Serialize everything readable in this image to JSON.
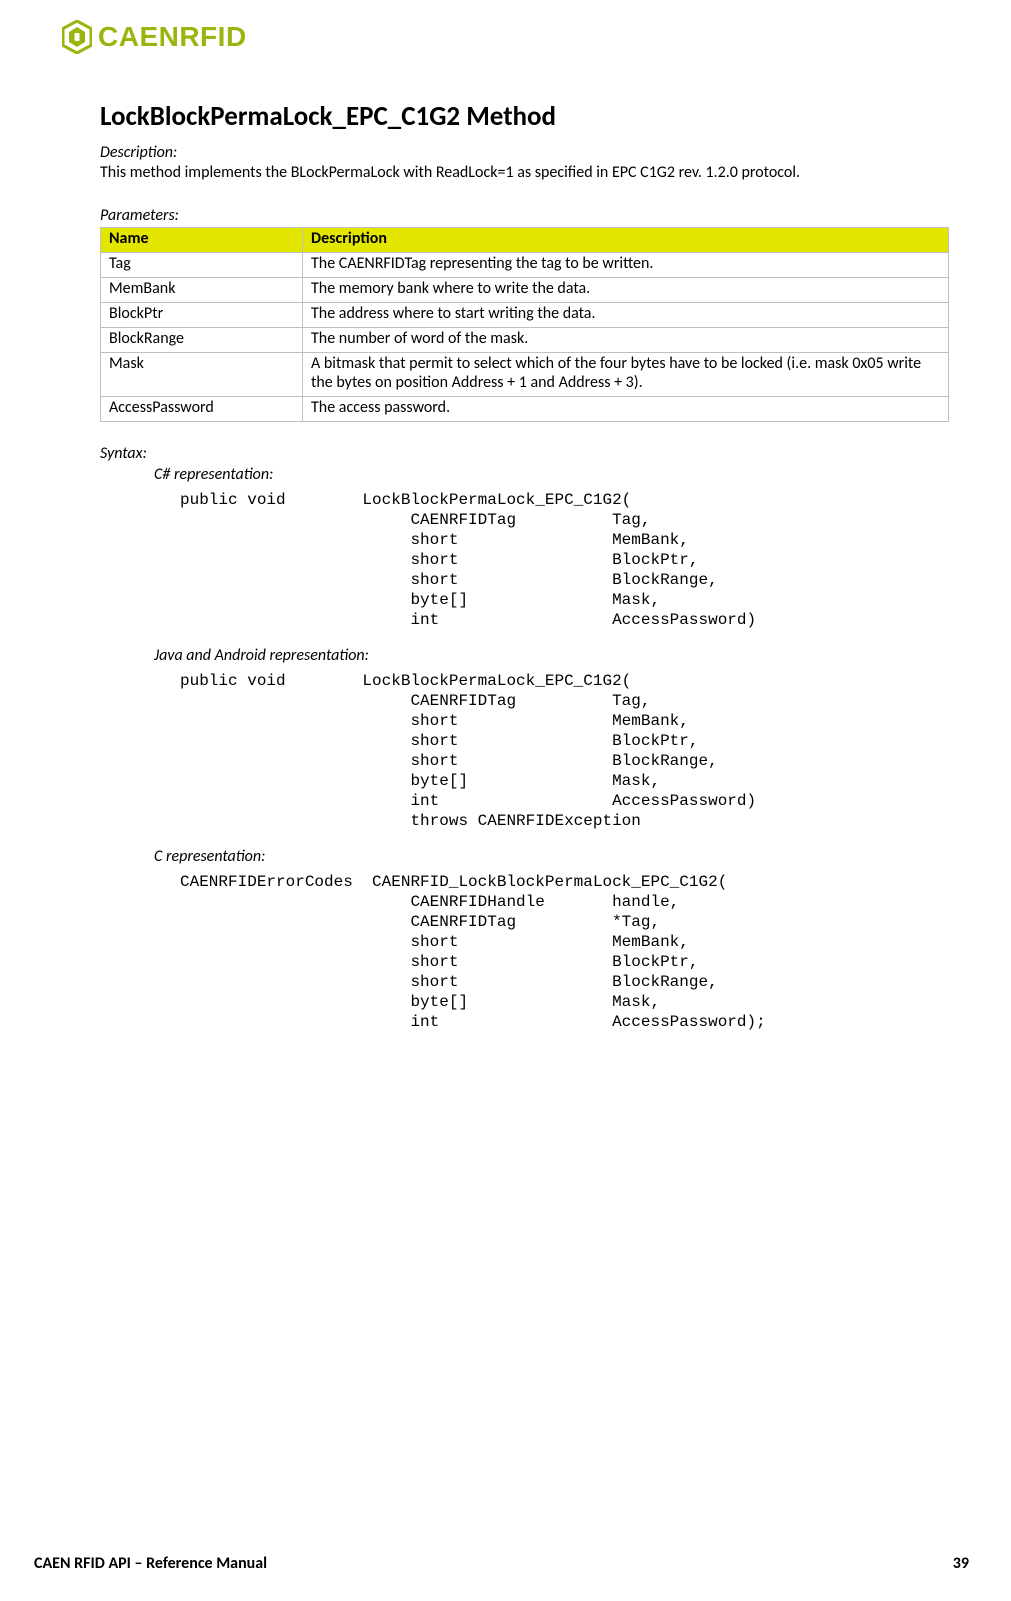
{
  "logo": {
    "brand_text": "CAENRFID"
  },
  "title": "LockBlockPermaLock_EPC_C1G2 Method",
  "description_label": "Description:",
  "description_text": "This method implements the BLockPermaLock with ReadLock=1 as specified in EPC C1G2 rev. 1.2.0 protocol.",
  "parameters_label": "Parameters:",
  "params_table": {
    "headers": {
      "name": "Name",
      "description": "Description"
    },
    "rows": [
      {
        "name": "Tag",
        "description": "The CAENRFIDTag representing the tag to be written."
      },
      {
        "name": "MemBank",
        "description": "The memory bank where to write the data."
      },
      {
        "name": "BlockPtr",
        "description": "The address where to start writing the data."
      },
      {
        "name": "BlockRange",
        "description": "The number of word of the mask."
      },
      {
        "name": "Mask",
        "description": "A bitmask that permit to select which of the four bytes have to be locked (i.e. mask 0x05 write the bytes on position Address + 1 and Address + 3)."
      },
      {
        "name": "AccessPassword",
        "description": "The access password."
      }
    ]
  },
  "syntax_label": "Syntax:",
  "repr": {
    "csharp_label": "C# representation:",
    "csharp_code": "public void        LockBlockPermaLock_EPC_C1G2(\n                        CAENRFIDTag          Tag,\n                        short                MemBank,\n                        short                BlockPtr,\n                        short                BlockRange,\n                        byte[]               Mask,\n                        int                  AccessPassword)",
    "java_label": "Java and Android representation:",
    "java_code": "public void        LockBlockPermaLock_EPC_C1G2(\n                        CAENRFIDTag          Tag,\n                        short                MemBank,\n                        short                BlockPtr,\n                        short                BlockRange,\n                        byte[]               Mask,\n                        int                  AccessPassword)\n                        throws CAENRFIDException",
    "c_label": "C representation:",
    "c_code": "CAENRFIDErrorCodes  CAENRFID_LockBlockPermaLock_EPC_C1G2(\n                        CAENRFIDHandle       handle,\n                        CAENRFIDTag          *Tag,\n                        short                MemBank,\n                        short                BlockPtr,\n                        short                BlockRange,\n                        byte[]               Mask,\n                        int                  AccessPassword);"
  },
  "footer": {
    "manual_title": "CAEN RFID API – Reference Manual",
    "page_number": "39"
  }
}
